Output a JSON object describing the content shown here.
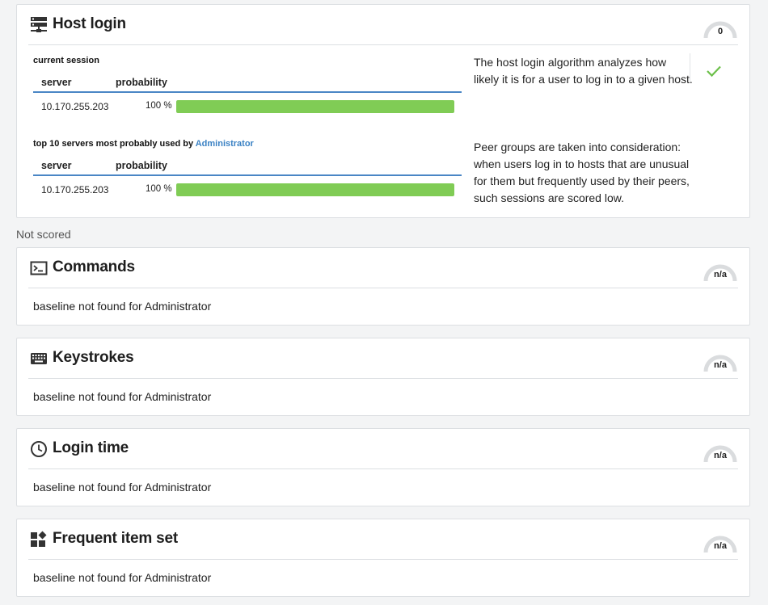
{
  "host_login": {
    "title": "Host login",
    "icon": "server-icon",
    "score": "0",
    "current_session": {
      "caption": "current session",
      "col_server": "server",
      "col_probability": "probability",
      "rows": [
        {
          "server": "10.170.255.203",
          "probability_label": "100 %",
          "probability": 1.0
        }
      ]
    },
    "top_servers": {
      "caption_prefix": "top 10 servers most probably used by ",
      "user": "Administrator",
      "col_server": "server",
      "col_probability": "probability",
      "rows": [
        {
          "server": "10.170.255.203",
          "probability_label": "100 %",
          "probability": 1.0
        }
      ]
    },
    "description_1": "The host login algorithm analyzes how likely it is for a user to log in to a given host.",
    "description_2": "Peer groups are taken into consideration: when users log in to hosts that are unusual for them but frequently used by their peers, such sessions are scored low.",
    "status_icon": "checkmark-icon"
  },
  "not_scored_label": "Not scored",
  "panels": [
    {
      "title": "Commands",
      "icon": "terminal-icon",
      "score": "n/a",
      "message": "baseline not found for Administrator"
    },
    {
      "title": "Keystrokes",
      "icon": "keyboard-icon",
      "score": "n/a",
      "message": "baseline not found for Administrator"
    },
    {
      "title": "Login time",
      "icon": "clock-icon",
      "score": "n/a",
      "message": "baseline not found for Administrator"
    },
    {
      "title": "Frequent item set",
      "icon": "widgets-icon",
      "score": "n/a",
      "message": "baseline not found for Administrator"
    }
  ],
  "colors": {
    "accent": "#4a86c5",
    "bar_fill": "#80cc55",
    "link": "#3b82c4",
    "check": "#6cc04a"
  }
}
